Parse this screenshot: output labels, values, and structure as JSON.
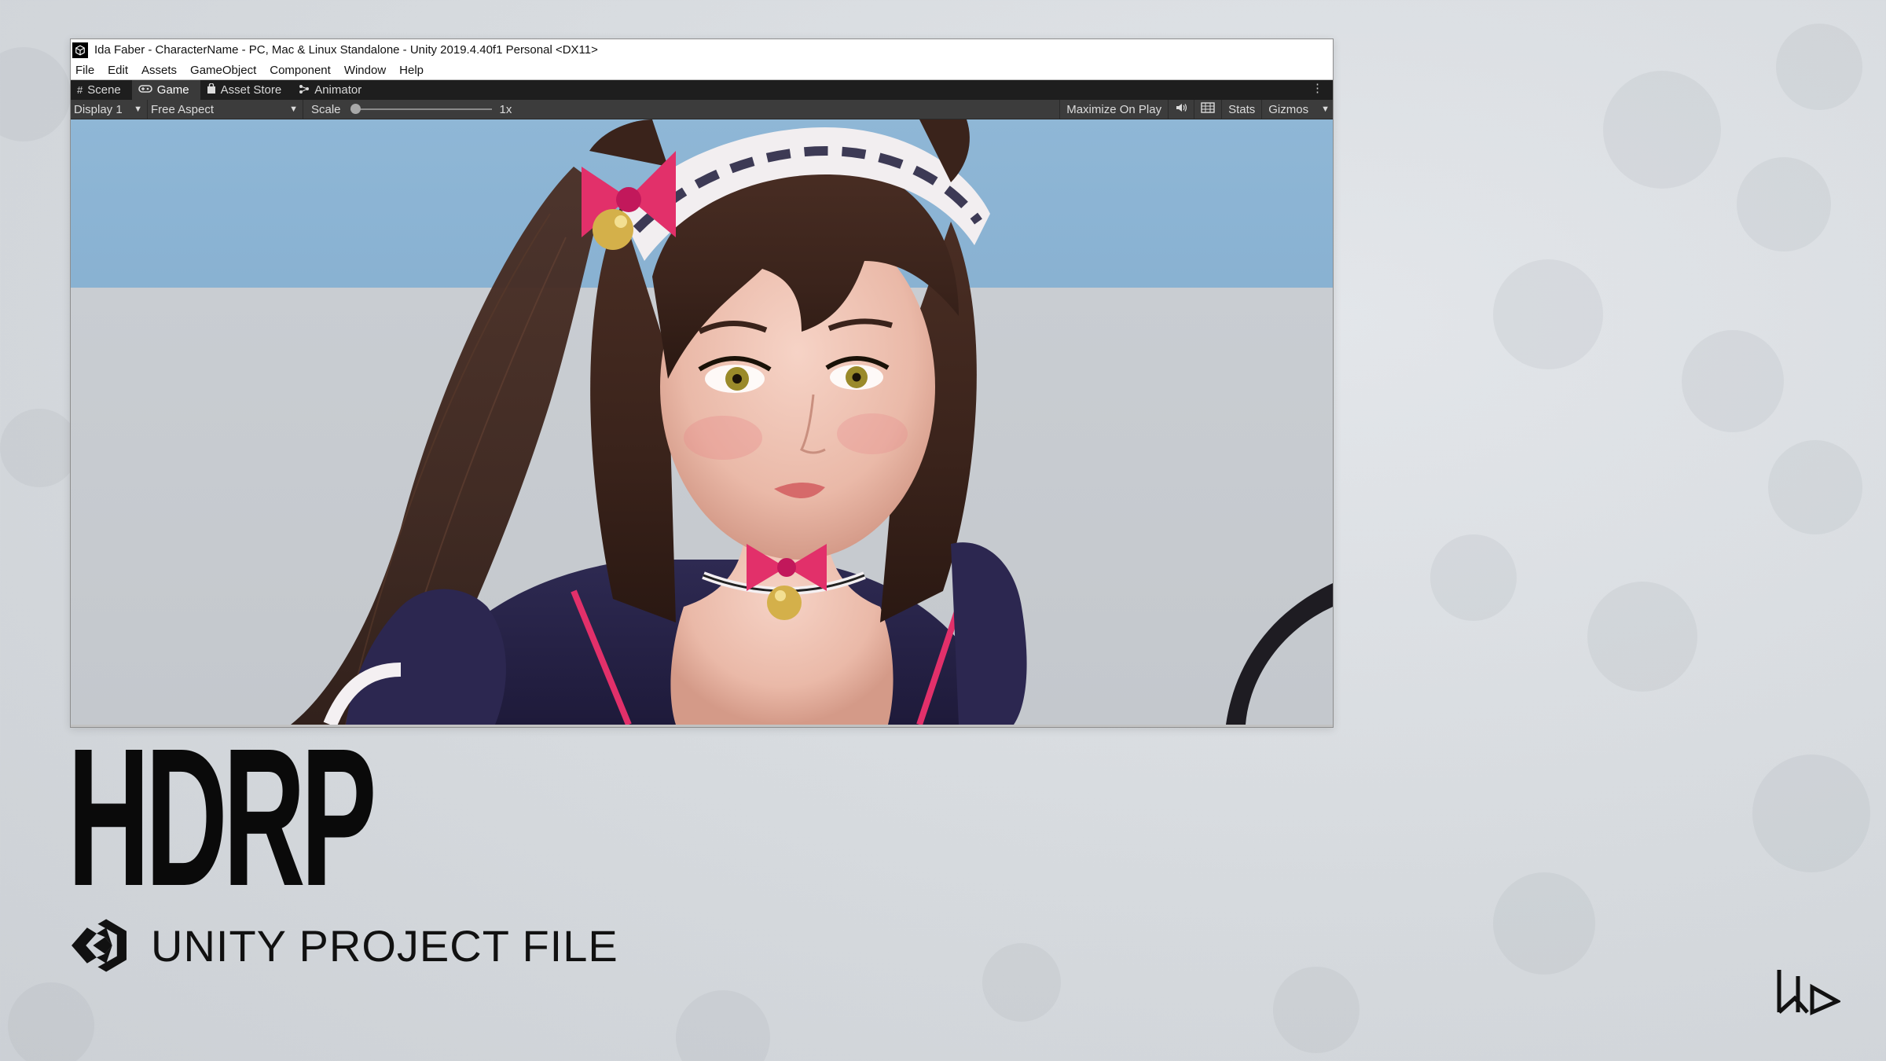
{
  "window": {
    "title": "Ida Faber - CharacterName - PC, Mac & Linux Standalone - Unity 2019.4.40f1 Personal <DX11>"
  },
  "menu": [
    "File",
    "Edit",
    "Assets",
    "GameObject",
    "Component",
    "Window",
    "Help"
  ],
  "tabs": [
    {
      "label": "Scene",
      "icon": "grid-icon"
    },
    {
      "label": "Game",
      "icon": "gamepad-icon"
    },
    {
      "label": "Asset Store",
      "icon": "bag-icon"
    },
    {
      "label": "Animator",
      "icon": "animator-icon"
    }
  ],
  "active_tab": "Game",
  "toolbar": {
    "display": "Display 1",
    "aspect": "Free Aspect",
    "scale_label": "Scale",
    "scale_value": "1x",
    "maximize": "Maximize On Play",
    "stats": "Stats",
    "gizmos": "Gizmos"
  },
  "slide": {
    "title": "HDRP",
    "subtitle": "UNITY PROJECT FILE"
  },
  "colors": {
    "sky": "#8fb7d6",
    "ground": "#c9cdd2",
    "dark_toolbar": "#3c3c3c",
    "tab_bar": "#1e1e1e"
  }
}
